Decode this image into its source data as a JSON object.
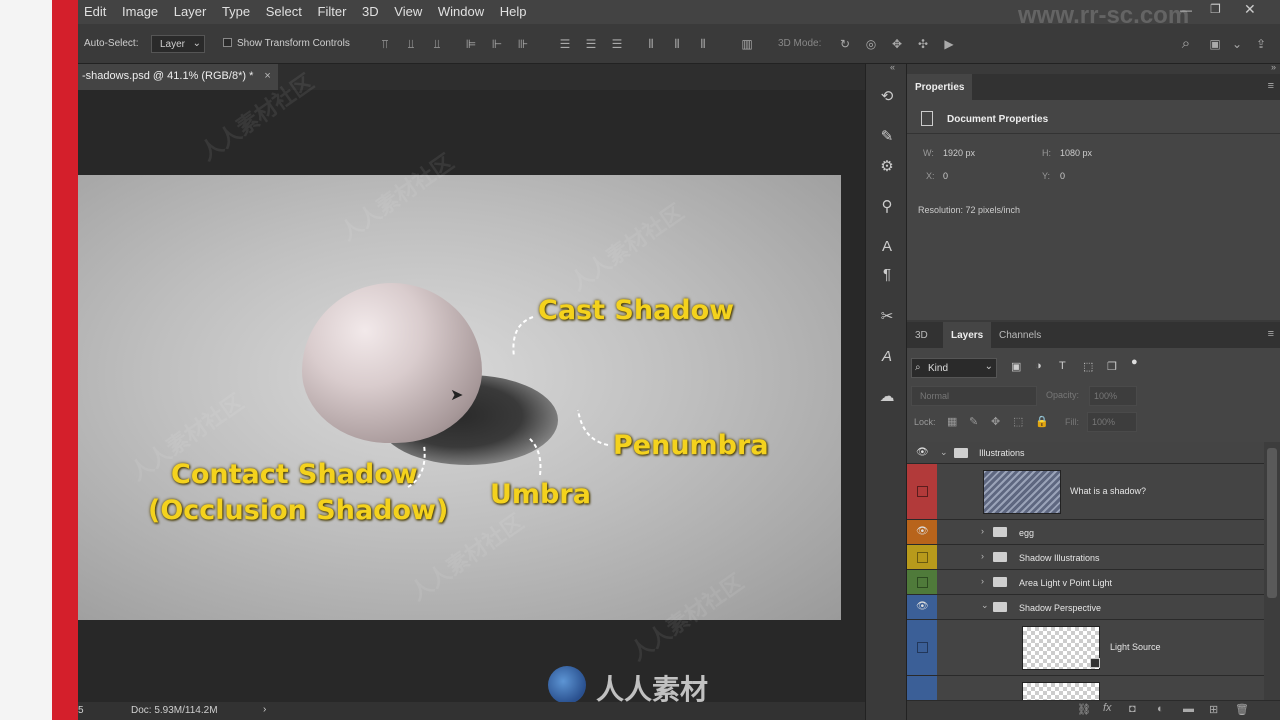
{
  "menubar": {
    "items": [
      "Edit",
      "Image",
      "Layer",
      "Type",
      "Select",
      "Filter",
      "3D",
      "View",
      "Window",
      "Help"
    ]
  },
  "watermark_text": "www.rr-sc.com",
  "options_bar": {
    "auto_select_label": "Auto-Select:",
    "auto_select_value": "Layer",
    "show_transform_label": "Show Transform Controls",
    "mode_3d_label": "3D Mode:"
  },
  "document": {
    "tab_title": "-shadows.psd @ 41.1% (RGB/8*) *",
    "close_glyph": "×",
    "doc_info": "Doc: 5.93M/114.2M",
    "status_left": "5"
  },
  "photo_annotations": {
    "cast_shadow": "Cast Shadow",
    "penumbra": "Penumbra",
    "umbra": "Umbra",
    "contact_shadow": "Contact Shadow",
    "occlusion_shadow": "(Occlusion Shadow)"
  },
  "properties": {
    "tab_label": "Properties",
    "section_title": "Document Properties",
    "w_label": "W:",
    "w_value": "1920 px",
    "h_label": "H:",
    "h_value": "1080 px",
    "x_label": "X:",
    "x_value": "0",
    "y_label": "Y:",
    "y_value": "0",
    "resolution": "Resolution: 72 pixels/inch"
  },
  "layers_panel": {
    "tabs": [
      "3D",
      "Layers",
      "Channels"
    ],
    "kind_label": "Kind",
    "blend_mode": "Normal",
    "opacity_label": "Opacity:",
    "opacity_value": "100%",
    "lock_label": "Lock:",
    "fill_label": "Fill:",
    "fill_value": "100%",
    "layers": [
      {
        "name": "Illustrations",
        "color": "#444444",
        "visible": true
      },
      {
        "name": "What is a shadow?",
        "color": "#b23a3a",
        "visible": false
      },
      {
        "name": "egg",
        "color": "#b8641b",
        "visible": true
      },
      {
        "name": "Shadow Illustrations",
        "color": "#b89a1b",
        "visible": false
      },
      {
        "name": "Area Light v Point Light",
        "color": "#4f7a3a",
        "visible": false
      },
      {
        "name": "Shadow Perspective",
        "color": "#3b5f97",
        "visible": true
      },
      {
        "name": "Light Source",
        "color": "#3b5f97",
        "visible": false
      }
    ]
  },
  "logo_text": "人人素材"
}
